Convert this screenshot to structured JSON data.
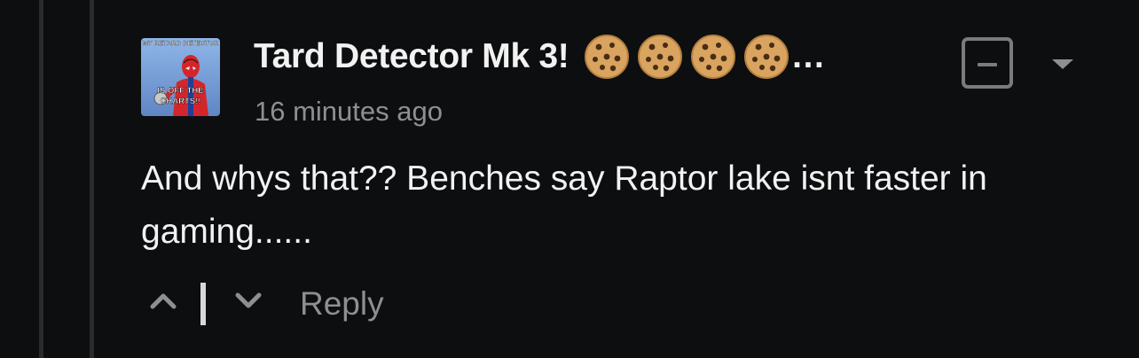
{
  "comment": {
    "avatar": {
      "caption_top": "MY RETARD DETECTOR",
      "caption_bottom_line1": "IS OFF THE",
      "caption_bottom_line2": "CHARTS!!"
    },
    "username": "Tard Detector Mk 3!",
    "flair_icons": [
      "cookie-emoji",
      "cookie-emoji",
      "cookie-emoji",
      "cookie-emoji"
    ],
    "truncation": "…",
    "timestamp": "16 minutes ago",
    "body": "And whys that?? Benches say Raptor lake isnt faster in gaming......",
    "actions": {
      "upvote_icon": "chevron-up-icon",
      "downvote_icon": "chevron-down-icon",
      "reply_label": "Reply",
      "collapse_icon": "minus-square-icon",
      "menu_icon": "caret-down-icon"
    }
  },
  "colors": {
    "background": "#0d0e10",
    "text_primary": "#f2f2f2",
    "text_secondary": "#8e8f93",
    "thread_line": "#2a2b2e"
  }
}
